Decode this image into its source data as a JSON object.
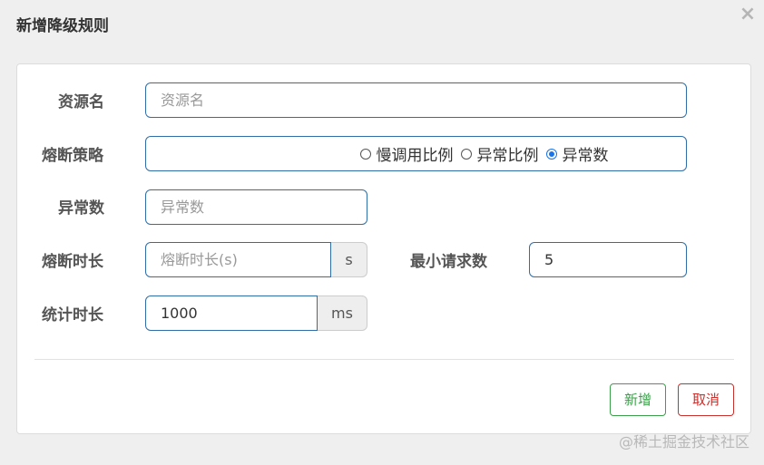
{
  "dialog": {
    "title": "新增降级规则",
    "close_symbol": "×"
  },
  "form": {
    "resource": {
      "label": "资源名",
      "value": "",
      "placeholder": "资源名"
    },
    "strategy": {
      "label": "熔断策略",
      "options": [
        {
          "label": "慢调用比例",
          "checked": false
        },
        {
          "label": "异常比例",
          "checked": false
        },
        {
          "label": "异常数",
          "checked": true
        }
      ]
    },
    "exception_count": {
      "label": "异常数",
      "value": "",
      "placeholder": "异常数"
    },
    "break_duration": {
      "label": "熔断时长",
      "value": "",
      "placeholder": "熔断时长(s)",
      "unit": "s"
    },
    "min_requests": {
      "label": "最小请求数",
      "value": "5"
    },
    "stat_duration": {
      "label": "统计时长",
      "value": "1000",
      "unit": "ms"
    }
  },
  "footer": {
    "add_label": "新增",
    "cancel_label": "取消"
  },
  "watermark": "@稀土掘金技术社区",
  "colors": {
    "input_border": "#2f6ea8",
    "radio_checked": "#1a73e8",
    "add_button": "#3ca04a",
    "cancel_button": "#c9302c"
  }
}
